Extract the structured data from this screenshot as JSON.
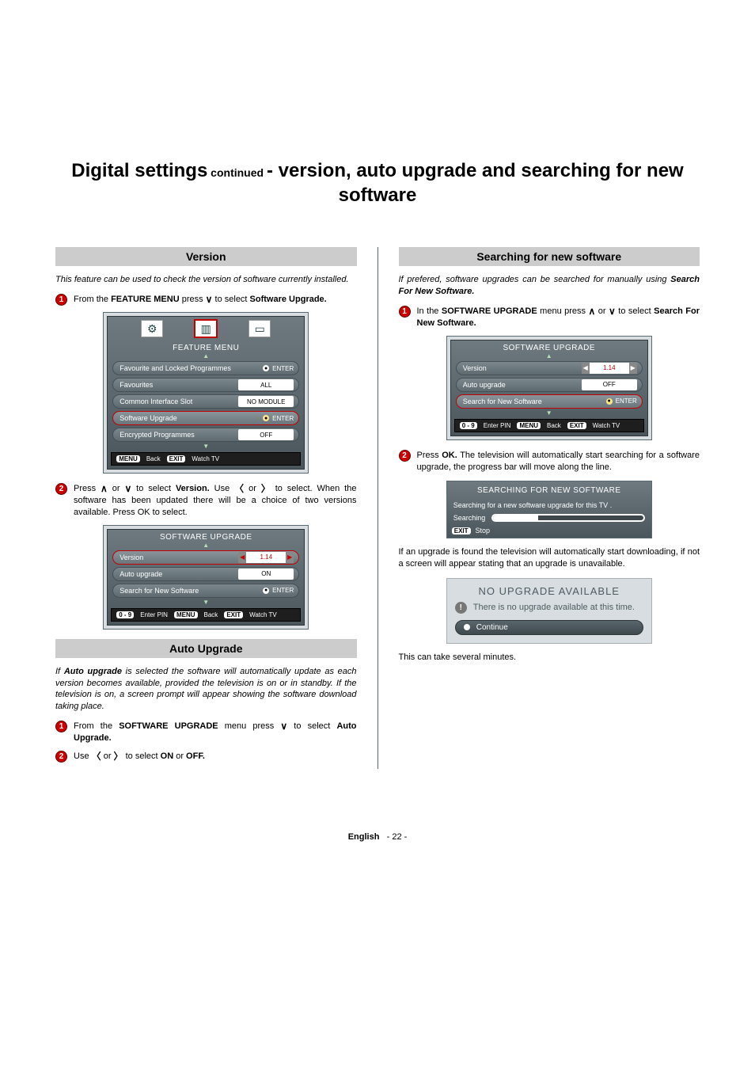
{
  "title": {
    "part1_big": "Digital settings",
    "part2_small": " continued ",
    "part3_big": "- version, auto upgrade and searching for new software"
  },
  "left": {
    "version": {
      "heading": "Version",
      "intro": "This feature can be used to check the version of software currently installed.",
      "step1_a": "From the ",
      "step1_b": "FEATURE MENU",
      "step1_c": " press ",
      "step1_d": " to select ",
      "step1_e": "Software Upgrade.",
      "feature_menu": {
        "title": "FEATURE MENU",
        "rows": [
          {
            "label": "Favourite and Locked Programmes",
            "type": "enter",
            "val": "ENTER"
          },
          {
            "label": "Favourites",
            "type": "val",
            "val": "ALL"
          },
          {
            "label": "Common Interface Slot",
            "type": "val",
            "val": "NO MODULE"
          },
          {
            "label": "Software Upgrade",
            "type": "enter",
            "val": "ENTER",
            "sel": true
          },
          {
            "label": "Encrypted Programmes",
            "type": "val",
            "val": "OFF"
          }
        ],
        "foot": {
          "menu": "MENU",
          "back": "Back",
          "exit": "EXIT",
          "watch": "Watch TV"
        }
      },
      "step2_a": "Press ",
      "step2_b": " or ",
      "step2_c": " to select ",
      "step2_d": "Version.",
      "step2_e": " Use ",
      "step2_f": " or ",
      "step2_g": " to select. When the software has been updated there will be a choice of two versions available. Press OK to select.",
      "sw_upgrade": {
        "title": "SOFTWARE UPGRADE",
        "rows": [
          {
            "label": "Version",
            "type": "spin",
            "val": "1.14",
            "sel": true
          },
          {
            "label": "Auto upgrade",
            "type": "val",
            "val": "ON"
          },
          {
            "label": "Search for New Software",
            "type": "enter",
            "val": "ENTER"
          }
        ],
        "foot": {
          "pin": "Enter PIN",
          "menu": "MENU",
          "back": "Back",
          "exit": "EXIT",
          "watch": "Watch TV",
          "digits": "0 - 9"
        }
      }
    },
    "auto": {
      "heading": "Auto Upgrade",
      "intro_a": "If ",
      "intro_b": "Auto upgrade",
      "intro_c": " is selected the software will automatically update as each version becomes available, provided the television is on or in standby.  If the television is on, a screen prompt will appear showing the software download taking place.",
      "step1_a": "From the ",
      "step1_b": "SOFTWARE UPGRADE",
      "step1_c": " menu press ",
      "step1_d": " to select ",
      "step1_e": "Auto Upgrade.",
      "step2_a": "Use ",
      "step2_b": " or ",
      "step2_c": " to select ",
      "step2_d": "ON",
      "step2_e": " or ",
      "step2_f": "OFF."
    }
  },
  "right": {
    "search": {
      "heading": "Searching for new software",
      "intro_a": "If prefered, software upgrades can be searched for manually using ",
      "intro_b": "Search For New Software.",
      "step1_a": "In the ",
      "step1_b": "SOFTWARE UPGRADE",
      "step1_c": " menu press ",
      "step1_d": " or ",
      "step1_e": " to select ",
      "step1_f": "Search For New Software.",
      "sw_upgrade": {
        "title": "SOFTWARE UPGRADE",
        "rows": [
          {
            "label": "Version",
            "type": "spin",
            "val": "1.14"
          },
          {
            "label": "Auto upgrade",
            "type": "val",
            "val": "OFF"
          },
          {
            "label": "Search for New Software",
            "type": "enter",
            "val": "ENTER",
            "sel": true
          }
        ],
        "foot": {
          "pin": "Enter PIN",
          "menu": "MENU",
          "back": "Back",
          "exit": "EXIT",
          "watch": "Watch TV",
          "digits": "0 - 9"
        }
      },
      "step2_a": "Press ",
      "step2_b": "OK.",
      "step2_c": " The television will automatically start searching for a software upgrade, the progress bar will move along the line.",
      "searching_box": {
        "title": "SEARCHING FOR NEW SOFTWARE",
        "text": "Searching for a new software upgrade for this TV .",
        "row_label": "Searching",
        "foot_exit": "EXIT",
        "foot_stop": "Stop"
      },
      "body3": "If an upgrade is found the television will automatically start downloading, if not a screen  will appear stating that an upgrade is unavailable.",
      "noupg": {
        "title": "NO UPGRADE AVAILABLE",
        "msg": "There is no upgrade available at this time.",
        "cont": "Continue"
      },
      "body4": "This can take several minutes."
    }
  },
  "footer": {
    "lang": "English",
    "sep": "-",
    "page": "22",
    "sep2": "-"
  }
}
